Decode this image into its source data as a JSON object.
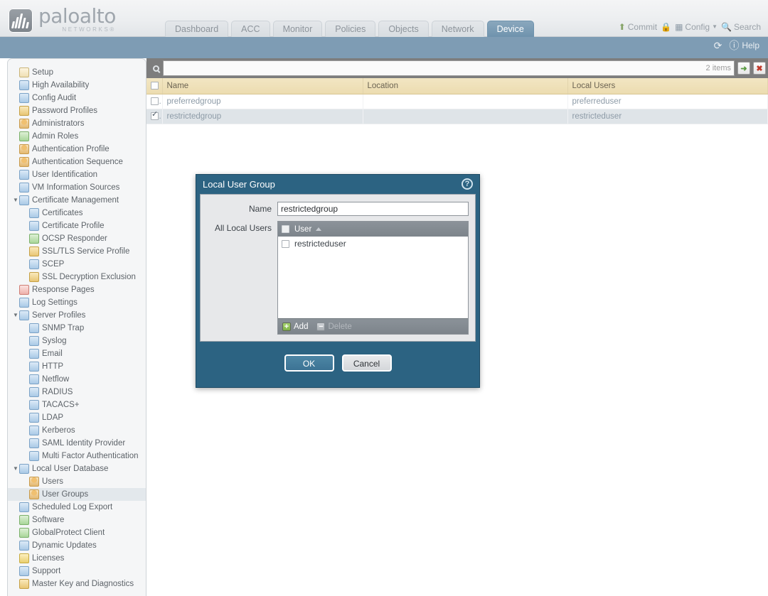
{
  "brand": {
    "name": "paloalto",
    "tagline": "NETWORKS®"
  },
  "nav": {
    "tabs": [
      {
        "label": "Dashboard",
        "active": false
      },
      {
        "label": "ACC",
        "active": false
      },
      {
        "label": "Monitor",
        "active": false
      },
      {
        "label": "Policies",
        "active": false
      },
      {
        "label": "Objects",
        "active": false
      },
      {
        "label": "Network",
        "active": false
      },
      {
        "label": "Device",
        "active": true
      }
    ],
    "actions": [
      {
        "label": "Commit",
        "icon": "commit-icon"
      },
      {
        "label": "",
        "icon": "lock-icon"
      },
      {
        "label": "Config",
        "icon": "config-icon"
      },
      {
        "label": "Search",
        "icon": "search-icon"
      }
    ]
  },
  "band": {
    "refresh_label": "",
    "help_label": "Help"
  },
  "sidebar": {
    "items": [
      {
        "label": "Setup",
        "indent": 0,
        "twisty": "",
        "icon": "setup-icon",
        "ico_class": "ic-doc",
        "selected": false
      },
      {
        "label": "High Availability",
        "indent": 0,
        "twisty": "",
        "icon": "high-availability-icon",
        "ico_class": "ic-blue",
        "selected": false
      },
      {
        "label": "Config Audit",
        "indent": 0,
        "twisty": "",
        "icon": "config-audit-icon",
        "ico_class": "ic-blue",
        "selected": false
      },
      {
        "label": "Password Profiles",
        "indent": 0,
        "twisty": "",
        "icon": "password-profiles-icon",
        "ico_class": "ic-lock",
        "selected": false
      },
      {
        "label": "Administrators",
        "indent": 0,
        "twisty": "",
        "icon": "administrators-icon",
        "ico_class": "ic-user",
        "selected": false
      },
      {
        "label": "Admin Roles",
        "indent": 0,
        "twisty": "",
        "icon": "admin-roles-icon",
        "ico_class": "ic-green",
        "selected": false
      },
      {
        "label": "Authentication Profile",
        "indent": 0,
        "twisty": "",
        "icon": "authentication-profile-icon",
        "ico_class": "ic-user",
        "selected": false
      },
      {
        "label": "Authentication Sequence",
        "indent": 0,
        "twisty": "",
        "icon": "authentication-sequence-icon",
        "ico_class": "ic-user",
        "selected": false
      },
      {
        "label": "User Identification",
        "indent": 0,
        "twisty": "",
        "icon": "user-identification-icon",
        "ico_class": "ic-blue",
        "selected": false
      },
      {
        "label": "VM Information Sources",
        "indent": 0,
        "twisty": "",
        "icon": "vm-information-sources-icon",
        "ico_class": "ic-blue",
        "selected": false
      },
      {
        "label": "Certificate Management",
        "indent": 0,
        "twisty": "▼",
        "icon": "certificate-management-icon",
        "ico_class": "ic-blue",
        "selected": false
      },
      {
        "label": "Certificates",
        "indent": 1,
        "twisty": "",
        "icon": "certificates-icon",
        "ico_class": "ic-blue",
        "selected": false
      },
      {
        "label": "Certificate Profile",
        "indent": 1,
        "twisty": "",
        "icon": "certificate-profile-icon",
        "ico_class": "ic-blue",
        "selected": false
      },
      {
        "label": "OCSP Responder",
        "indent": 1,
        "twisty": "",
        "icon": "ocsp-responder-icon",
        "ico_class": "ic-green",
        "selected": false
      },
      {
        "label": "SSL/TLS Service Profile",
        "indent": 1,
        "twisty": "",
        "icon": "ssl-tls-service-profile-icon",
        "ico_class": "ic-lock",
        "selected": false
      },
      {
        "label": "SCEP",
        "indent": 1,
        "twisty": "",
        "icon": "scep-icon",
        "ico_class": "ic-blue",
        "selected": false
      },
      {
        "label": "SSL Decryption Exclusion",
        "indent": 1,
        "twisty": "",
        "icon": "ssl-decryption-exclusion-icon",
        "ico_class": "ic-lock",
        "selected": false
      },
      {
        "label": "Response Pages",
        "indent": 0,
        "twisty": "",
        "icon": "response-pages-icon",
        "ico_class": "ic-red",
        "selected": false
      },
      {
        "label": "Log Settings",
        "indent": 0,
        "twisty": "",
        "icon": "log-settings-icon",
        "ico_class": "ic-blue",
        "selected": false
      },
      {
        "label": "Server Profiles",
        "indent": 0,
        "twisty": "▼",
        "icon": "server-profiles-icon",
        "ico_class": "ic-blue",
        "selected": false
      },
      {
        "label": "SNMP Trap",
        "indent": 1,
        "twisty": "",
        "icon": "snmp-trap-icon",
        "ico_class": "ic-blue",
        "selected": false
      },
      {
        "label": "Syslog",
        "indent": 1,
        "twisty": "",
        "icon": "syslog-icon",
        "ico_class": "ic-blue",
        "selected": false
      },
      {
        "label": "Email",
        "indent": 1,
        "twisty": "",
        "icon": "email-icon",
        "ico_class": "ic-blue",
        "selected": false
      },
      {
        "label": "HTTP",
        "indent": 1,
        "twisty": "",
        "icon": "http-icon",
        "ico_class": "ic-blue",
        "selected": false
      },
      {
        "label": "Netflow",
        "indent": 1,
        "twisty": "",
        "icon": "netflow-icon",
        "ico_class": "ic-blue",
        "selected": false
      },
      {
        "label": "RADIUS",
        "indent": 1,
        "twisty": "",
        "icon": "radius-icon",
        "ico_class": "ic-blue",
        "selected": false
      },
      {
        "label": "TACACS+",
        "indent": 1,
        "twisty": "",
        "icon": "tacacs-icon",
        "ico_class": "ic-blue",
        "selected": false
      },
      {
        "label": "LDAP",
        "indent": 1,
        "twisty": "",
        "icon": "ldap-icon",
        "ico_class": "ic-blue",
        "selected": false
      },
      {
        "label": "Kerberos",
        "indent": 1,
        "twisty": "",
        "icon": "kerberos-icon",
        "ico_class": "ic-blue",
        "selected": false
      },
      {
        "label": "SAML Identity Provider",
        "indent": 1,
        "twisty": "",
        "icon": "saml-identity-provider-icon",
        "ico_class": "ic-blue",
        "selected": false
      },
      {
        "label": "Multi Factor Authentication",
        "indent": 1,
        "twisty": "",
        "icon": "multi-factor-authentication-icon",
        "ico_class": "ic-blue",
        "selected": false
      },
      {
        "label": "Local User Database",
        "indent": 0,
        "twisty": "▼",
        "icon": "local-user-database-icon",
        "ico_class": "ic-blue",
        "selected": false
      },
      {
        "label": "Users",
        "indent": 1,
        "twisty": "",
        "icon": "users-icon",
        "ico_class": "ic-user",
        "selected": false
      },
      {
        "label": "User Groups",
        "indent": 1,
        "twisty": "",
        "icon": "user-groups-icon",
        "ico_class": "ic-user",
        "selected": true
      },
      {
        "label": "Scheduled Log Export",
        "indent": 0,
        "twisty": "",
        "icon": "scheduled-log-export-icon",
        "ico_class": "ic-blue",
        "selected": false
      },
      {
        "label": "Software",
        "indent": 0,
        "twisty": "",
        "icon": "software-icon",
        "ico_class": "ic-green",
        "selected": false
      },
      {
        "label": "GlobalProtect Client",
        "indent": 0,
        "twisty": "",
        "icon": "globalprotect-client-icon",
        "ico_class": "ic-green",
        "selected": false
      },
      {
        "label": "Dynamic Updates",
        "indent": 0,
        "twisty": "",
        "icon": "dynamic-updates-icon",
        "ico_class": "ic-blue",
        "selected": false
      },
      {
        "label": "Licenses",
        "indent": 0,
        "twisty": "",
        "icon": "licenses-icon",
        "ico_class": "ic-key",
        "selected": false
      },
      {
        "label": "Support",
        "indent": 0,
        "twisty": "",
        "icon": "support-icon",
        "ico_class": "ic-blue",
        "selected": false
      },
      {
        "label": "Master Key and Diagnostics",
        "indent": 0,
        "twisty": "",
        "icon": "master-key-and-diagnostics-icon",
        "ico_class": "ic-lock",
        "selected": false
      }
    ]
  },
  "search": {
    "value": "",
    "placeholder": "",
    "items_count": "2 items",
    "apply_label": "➜",
    "clear_label": "✖"
  },
  "table": {
    "columns": [
      "Name",
      "Location",
      "Local Users"
    ],
    "rows": [
      {
        "checked": false,
        "name": "preferredgroup",
        "location": "",
        "local_users": "preferreduser",
        "selected": false
      },
      {
        "checked": true,
        "name": "restrictedgroup",
        "location": "",
        "local_users": "restricteduser",
        "selected": true
      }
    ]
  },
  "modal": {
    "title": "Local User Group",
    "help_glyph": "?",
    "name_label": "Name",
    "name_value": "restrictedgroup",
    "all_local_users_label": "All Local Users",
    "list_header": "User",
    "list_rows": [
      {
        "checked": false,
        "label": "restricteduser"
      }
    ],
    "add_label": "Add",
    "delete_label": "Delete",
    "ok_label": "OK",
    "cancel_label": "Cancel"
  }
}
